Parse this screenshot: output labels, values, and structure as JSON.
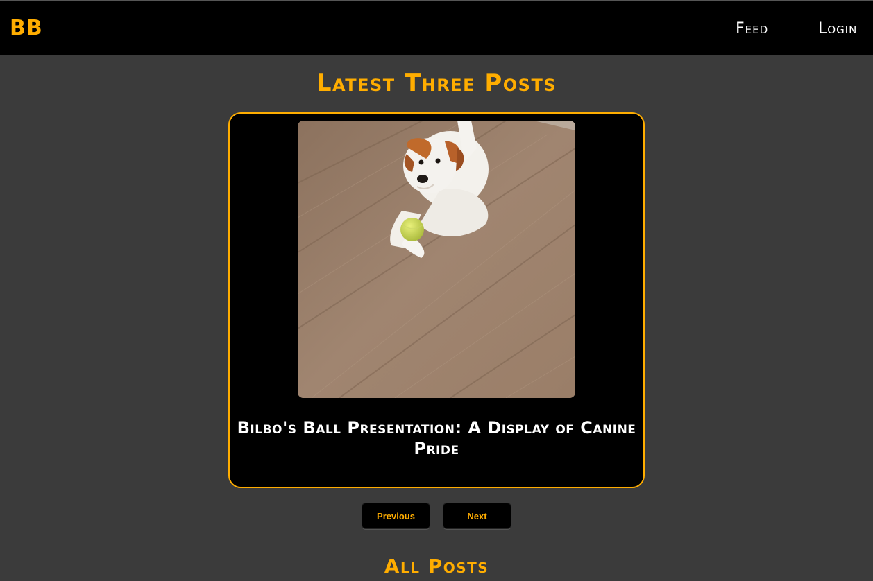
{
  "header": {
    "brand": "BB",
    "nav": [
      {
        "label": "Feed"
      },
      {
        "label": "Login"
      }
    ]
  },
  "latest": {
    "title": "Latest Three Posts",
    "post": {
      "title": "Bilbo's Ball Presentation: A Display of Canine Pride",
      "image_alt": "Jack Russell terrier lying on wooden floor with a tennis ball"
    }
  },
  "pager": {
    "previous_label": "Previous",
    "next_label": "Next"
  },
  "all_posts": {
    "title": "All Posts"
  },
  "colors": {
    "accent": "#ffad00",
    "background": "#3b3b3b",
    "header_bg": "#000000",
    "card_bg": "#000000"
  }
}
